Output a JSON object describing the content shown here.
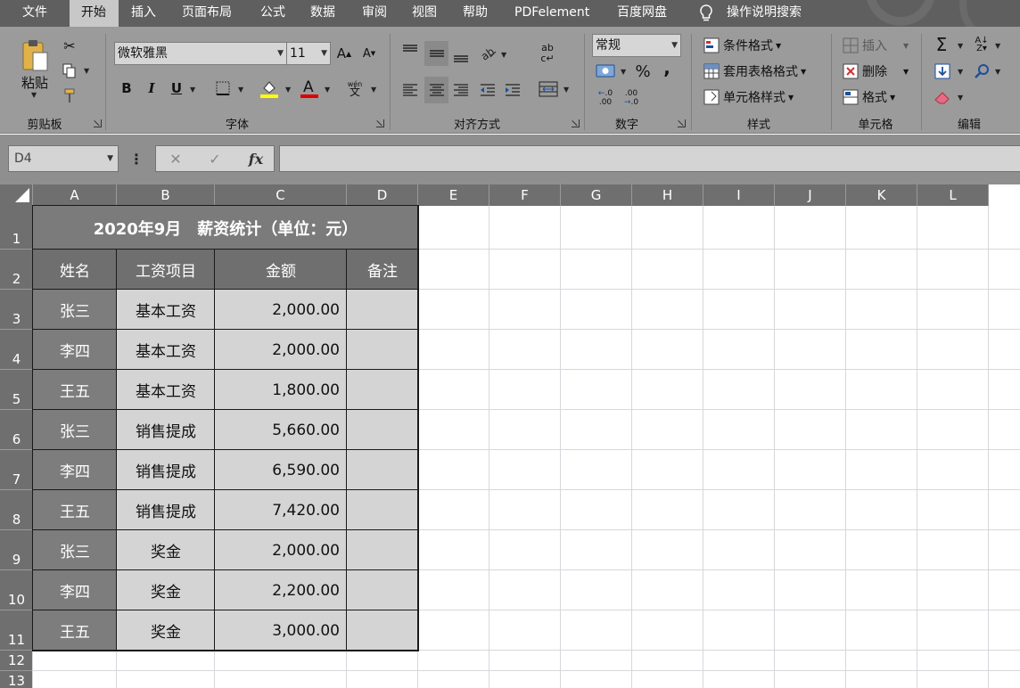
{
  "ribbon_tabs": [
    "文件",
    "开始",
    "插入",
    "页面布局",
    "公式",
    "数据",
    "审阅",
    "视图",
    "帮助",
    "PDFelement",
    "百度网盘"
  ],
  "tell_me": "操作说明搜索",
  "clipboard": {
    "paste": "粘贴",
    "label": "剪贴板"
  },
  "font": {
    "name": "微软雅黑",
    "size": "11",
    "label": "字体",
    "bold": "B",
    "italic": "I",
    "underline": "U"
  },
  "alignment": {
    "label": "对齐方式"
  },
  "number": {
    "format": "常规",
    "percent": "%",
    "comma": ",",
    "label": "数字"
  },
  "styles": {
    "conditional": "条件格式",
    "table": "套用表格格式",
    "cell": "单元格样式",
    "label": "样式"
  },
  "cells": {
    "insert": "插入",
    "delete": "删除",
    "format": "格式",
    "label": "单元格"
  },
  "editing": {
    "label": "编辑"
  },
  "formula_bar": {
    "name_box": "D4",
    "fx": "fx",
    "value": ""
  },
  "columns": [
    "A",
    "B",
    "C",
    "D",
    "E",
    "F",
    "G",
    "H",
    "I",
    "J",
    "K",
    "L"
  ],
  "rows": [
    "1",
    "2",
    "3",
    "4",
    "5",
    "6",
    "7",
    "8",
    "9",
    "10",
    "11",
    "12",
    "13"
  ],
  "table": {
    "title": "2020年9月　薪资统计（单位：元）",
    "headers": [
      "姓名",
      "工资项目",
      "金额",
      "备注"
    ],
    "body": [
      [
        "张三",
        "基本工资",
        "2,000.00",
        ""
      ],
      [
        "李四",
        "基本工资",
        "2,000.00",
        ""
      ],
      [
        "王五",
        "基本工资",
        "1,800.00",
        ""
      ],
      [
        "张三",
        "销售提成",
        "5,660.00",
        ""
      ],
      [
        "李四",
        "销售提成",
        "6,590.00",
        ""
      ],
      [
        "王五",
        "销售提成",
        "7,420.00",
        ""
      ],
      [
        "张三",
        "奖金",
        "2,000.00",
        ""
      ],
      [
        "李四",
        "奖金",
        "2,200.00",
        ""
      ],
      [
        "王五",
        "奖金",
        "3,000.00",
        ""
      ]
    ]
  },
  "colors": {
    "tab_bar": "#5f5f5f",
    "ribbon": "#9b9b9b",
    "header": "#6f6f6f",
    "title_bg": "#7b7b7b",
    "name_col_bg": "#7d7d7d",
    "body_bg": "#d4d4d4",
    "grid": "#d5d8dc"
  }
}
